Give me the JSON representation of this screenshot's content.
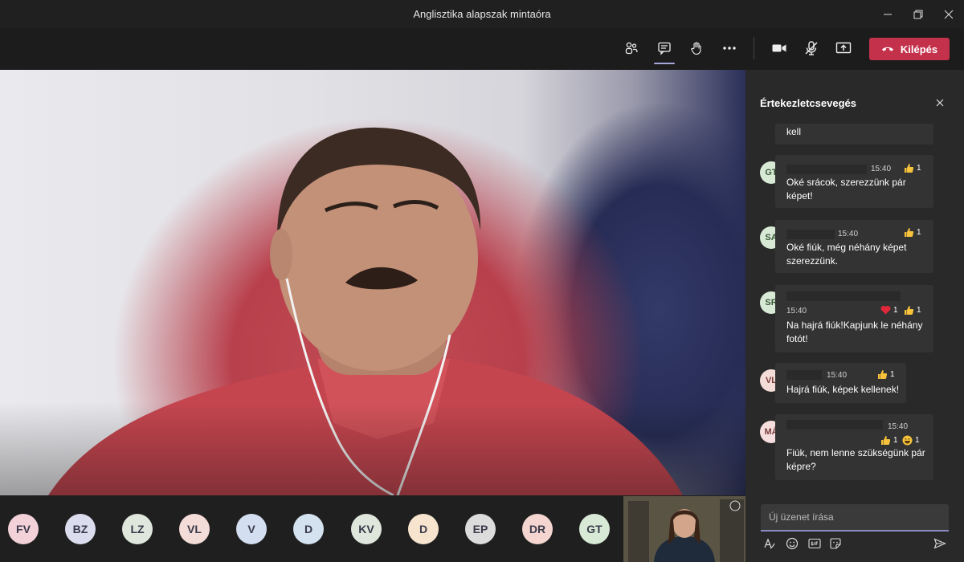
{
  "window": {
    "title": "Anglisztika alapszak mintaóra"
  },
  "toolbar": {
    "leave_label": "Kilépés"
  },
  "chat": {
    "title": "Értekezletcsevegés",
    "compose_placeholder": "Új üzenet írása",
    "partial_text": "kell",
    "messages": [
      {
        "initials": "GT",
        "time": "15:40",
        "text": "Oké srácok, szerezzünk pár képet!",
        "r1_icon": "thumbs-up",
        "r1_count": "1"
      },
      {
        "initials": "SA",
        "time": "15:40",
        "text": "Oké fiúk, még néhány képet szerezzünk.",
        "r1_icon": "thumbs-up",
        "r1_count": "1"
      },
      {
        "initials": "SR",
        "time": "15:40",
        "text": "Na hajrá fiúk!Kapjunk le néhány fotót!",
        "r1_icon": "heart",
        "r1_count": "1",
        "r2_icon": "thumbs-up",
        "r2_count": "1"
      },
      {
        "initials": "VL",
        "time": "15:40",
        "text": "Hajrá fiúk, képek kellenek!",
        "r1_icon": "thumbs-up",
        "r1_count": "1"
      },
      {
        "initials": "MÁ",
        "time": "15:40",
        "text": "Fiúk, nem lenne szükségünk pár képre?",
        "r1_icon": "thumbs-up",
        "r1_count": "1",
        "r2_icon": "laugh",
        "r2_count": "1"
      }
    ]
  },
  "participants": [
    {
      "initials": "FV",
      "color": "#f3d1d9"
    },
    {
      "initials": "BZ",
      "color": "#dcdcef"
    },
    {
      "initials": "LZ",
      "color": "#dfe7dd"
    },
    {
      "initials": "VL",
      "color": "#f4dcd9"
    },
    {
      "initials": "V",
      "color": "#d3def0"
    },
    {
      "initials": "D",
      "color": "#d4e1ee"
    },
    {
      "initials": "KV",
      "color": "#dfe7dd"
    },
    {
      "initials": "D",
      "color": "#f7e4cf"
    },
    {
      "initials": "EP",
      "color": "#dcdcdc"
    },
    {
      "initials": "DR",
      "color": "#f4d5d0"
    },
    {
      "initials": "GT",
      "color": "#d8ead6"
    }
  ],
  "colors": {
    "leave": "#c4314b",
    "accent": "#8b8cc7"
  }
}
